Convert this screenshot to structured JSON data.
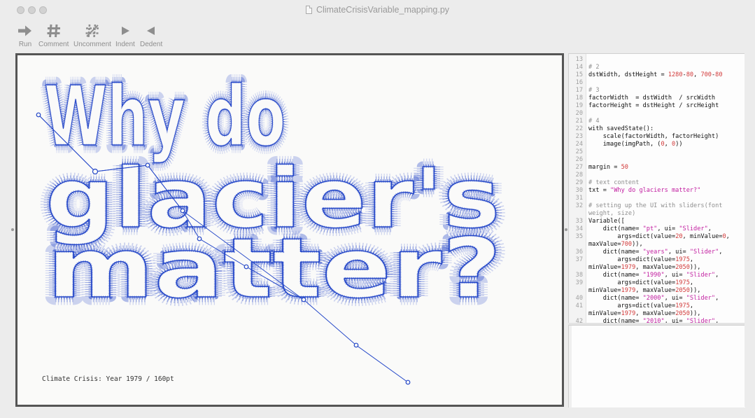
{
  "window": {
    "title": "ClimateCrisisVariable_mapping.py"
  },
  "toolbar": {
    "run": {
      "label": "Run",
      "icon": "arrow-right-icon"
    },
    "comment": {
      "label": "Comment",
      "icon": "hash-icon"
    },
    "uncomment": {
      "label": "Uncomment",
      "icon": "hash-strike-icon"
    },
    "indent": {
      "label": "Indent",
      "icon": "triangle-right-icon"
    },
    "dedent": {
      "label": "Dedent",
      "icon": "triangle-left-icon"
    }
  },
  "canvas": {
    "lines": [
      "Why do",
      "glacier's",
      "matter?"
    ],
    "caption": "Climate Crisis: Year 1979 / 160pt",
    "stroke_color": "#2346c8"
  },
  "editor": {
    "lines": [
      {
        "n": "13",
        "t": [
          [
            "",
            "c-plain"
          ]
        ]
      },
      {
        "n": "14",
        "t": [
          [
            "# 2",
            "c-comment"
          ]
        ]
      },
      {
        "n": "15",
        "t": [
          [
            "dstWidth, dstHeight = ",
            "c-plain"
          ],
          [
            "1280",
            "c-number"
          ],
          [
            "-",
            "c-plain"
          ],
          [
            "80",
            "c-number"
          ],
          [
            ", ",
            "c-plain"
          ],
          [
            "700",
            "c-number"
          ],
          [
            "-",
            "c-plain"
          ],
          [
            "80",
            "c-number"
          ]
        ]
      },
      {
        "n": "16",
        "t": [
          [
            "",
            "c-plain"
          ]
        ]
      },
      {
        "n": "17",
        "t": [
          [
            "# 3",
            "c-comment"
          ]
        ]
      },
      {
        "n": "18",
        "t": [
          [
            "factorWidth  = dstWidth  / srcWidth",
            "c-plain"
          ]
        ]
      },
      {
        "n": "19",
        "t": [
          [
            "factorHeight = dstHeight / srcHeight",
            "c-plain"
          ]
        ]
      },
      {
        "n": "20",
        "t": [
          [
            "",
            "c-plain"
          ]
        ]
      },
      {
        "n": "21",
        "t": [
          [
            "# 4",
            "c-comment"
          ]
        ]
      },
      {
        "n": "22",
        "t": [
          [
            "with savedState():",
            "c-plain"
          ]
        ]
      },
      {
        "n": "23",
        "t": [
          [
            "    scale(factorWidth, factorHeight)",
            "c-plain"
          ]
        ]
      },
      {
        "n": "24",
        "t": [
          [
            "    image(imgPath, (",
            "c-plain"
          ],
          [
            "0",
            "c-number"
          ],
          [
            ", ",
            "c-plain"
          ],
          [
            "0",
            "c-number"
          ],
          [
            "))",
            "c-plain"
          ]
        ]
      },
      {
        "n": "25",
        "t": [
          [
            "",
            "c-plain"
          ]
        ]
      },
      {
        "n": "26",
        "t": [
          [
            "",
            "c-plain"
          ]
        ]
      },
      {
        "n": "27",
        "t": [
          [
            "margin = ",
            "c-plain"
          ],
          [
            "50",
            "c-number"
          ]
        ]
      },
      {
        "n": "28",
        "t": [
          [
            "",
            "c-plain"
          ]
        ]
      },
      {
        "n": "29",
        "t": [
          [
            "# text content",
            "c-comment"
          ]
        ]
      },
      {
        "n": "30",
        "t": [
          [
            "txt = ",
            "c-plain"
          ],
          [
            "\"Why do glaciers matter?\"",
            "c-string"
          ]
        ]
      },
      {
        "n": "31",
        "t": [
          [
            "",
            "c-plain"
          ]
        ]
      },
      {
        "n": "32",
        "t": [
          [
            "# setting up the UI with sliders(font",
            "c-comment"
          ]
        ]
      },
      {
        "n": "",
        "t": [
          [
            "weight, size)",
            "c-comment"
          ]
        ]
      },
      {
        "n": "33",
        "t": [
          [
            "Variable([",
            "c-plain"
          ]
        ]
      },
      {
        "n": "34",
        "t": [
          [
            "    dict(name= ",
            "c-plain"
          ],
          [
            "\"pt\"",
            "c-string"
          ],
          [
            ", ui= ",
            "c-plain"
          ],
          [
            "\"Slider\"",
            "c-string"
          ],
          [
            ",",
            "c-plain"
          ]
        ]
      },
      {
        "n": "35",
        "t": [
          [
            "        args=dict(value=",
            "c-plain"
          ],
          [
            "20",
            "c-number"
          ],
          [
            ", minValue=",
            "c-plain"
          ],
          [
            "0",
            "c-number"
          ],
          [
            ",",
            "c-plain"
          ]
        ]
      },
      {
        "n": "",
        "t": [
          [
            "maxValue=",
            "c-plain"
          ],
          [
            "700",
            "c-number"
          ],
          [
            ")),",
            "c-plain"
          ]
        ]
      },
      {
        "n": "36",
        "t": [
          [
            "    dict(name= ",
            "c-plain"
          ],
          [
            "\"years\"",
            "c-string"
          ],
          [
            ", ui= ",
            "c-plain"
          ],
          [
            "\"Slider\"",
            "c-string"
          ],
          [
            ",",
            "c-plain"
          ]
        ]
      },
      {
        "n": "37",
        "t": [
          [
            "        args=dict(value=",
            "c-plain"
          ],
          [
            "1975",
            "c-number"
          ],
          [
            ",",
            "c-plain"
          ]
        ]
      },
      {
        "n": "",
        "t": [
          [
            "minValue=",
            "c-plain"
          ],
          [
            "1979",
            "c-number"
          ],
          [
            ", maxValue=",
            "c-plain"
          ],
          [
            "2050",
            "c-number"
          ],
          [
            ")),",
            "c-plain"
          ]
        ]
      },
      {
        "n": "38",
        "t": [
          [
            "    dict(name= ",
            "c-plain"
          ],
          [
            "\"1990\"",
            "c-string"
          ],
          [
            ", ui= ",
            "c-plain"
          ],
          [
            "\"Slider\"",
            "c-string"
          ],
          [
            ",",
            "c-plain"
          ]
        ]
      },
      {
        "n": "39",
        "t": [
          [
            "        args=dict(value=",
            "c-plain"
          ],
          [
            "1975",
            "c-number"
          ],
          [
            ",",
            "c-plain"
          ]
        ]
      },
      {
        "n": "",
        "t": [
          [
            "minValue=",
            "c-plain"
          ],
          [
            "1979",
            "c-number"
          ],
          [
            ", maxValue=",
            "c-plain"
          ],
          [
            "2050",
            "c-number"
          ],
          [
            ")),",
            "c-plain"
          ]
        ]
      },
      {
        "n": "40",
        "t": [
          [
            "    dict(name= ",
            "c-plain"
          ],
          [
            "\"2000\"",
            "c-string"
          ],
          [
            ", ui= ",
            "c-plain"
          ],
          [
            "\"Slider\"",
            "c-string"
          ],
          [
            ",",
            "c-plain"
          ]
        ]
      },
      {
        "n": "41",
        "t": [
          [
            "        args=dict(value=",
            "c-plain"
          ],
          [
            "1975",
            "c-number"
          ],
          [
            ",",
            "c-plain"
          ]
        ]
      },
      {
        "n": "",
        "t": [
          [
            "minValue=",
            "c-plain"
          ],
          [
            "1979",
            "c-number"
          ],
          [
            ", maxValue=",
            "c-plain"
          ],
          [
            "2050",
            "c-number"
          ],
          [
            ")),",
            "c-plain"
          ]
        ]
      },
      {
        "n": "42",
        "t": [
          [
            "    dict(name= ",
            "c-plain"
          ],
          [
            "\"2010\"",
            "c-string"
          ],
          [
            ", ui= ",
            "c-plain"
          ],
          [
            "\"Slider\"",
            "c-string"
          ],
          [
            ",",
            "c-plain"
          ]
        ]
      }
    ]
  }
}
